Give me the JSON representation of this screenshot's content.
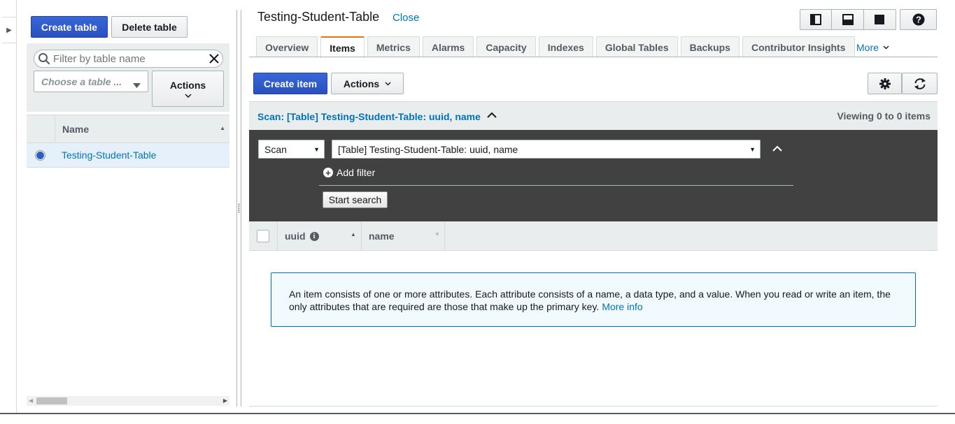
{
  "left_panel": {
    "create_table_label": "Create table",
    "delete_table_label": "Delete table",
    "filter_placeholder": "Filter by table name",
    "choose_table_placeholder": "Choose a table ...",
    "actions_label": "Actions",
    "column_header": "Name",
    "tables": [
      {
        "name": "Testing-Student-Table",
        "selected": true
      }
    ]
  },
  "detail": {
    "title": "Testing-Student-Table",
    "close_label": "Close",
    "tabs": [
      {
        "label": "Overview",
        "active": false
      },
      {
        "label": "Items",
        "active": true
      },
      {
        "label": "Metrics",
        "active": false
      },
      {
        "label": "Alarms",
        "active": false
      },
      {
        "label": "Capacity",
        "active": false
      },
      {
        "label": "Indexes",
        "active": false
      },
      {
        "label": "Global Tables",
        "active": false
      },
      {
        "label": "Backups",
        "active": false
      },
      {
        "label": "Contributor Insights",
        "active": false
      }
    ],
    "more_label": "More"
  },
  "items": {
    "create_item_label": "Create item",
    "actions_label": "Actions",
    "scan_summary": "Scan: [Table] Testing-Student-Table: uuid, name",
    "viewing_text": "Viewing 0 to 0 items",
    "operation_value": "Scan",
    "target_value": "[Table] Testing-Student-Table: uuid, name",
    "add_filter_label": "Add filter",
    "start_search_label": "Start search",
    "columns": [
      "uuid",
      "name"
    ],
    "info_text": "An item consists of one or more attributes. Each attribute consists of a name, a data type, and a value. When you read or write an item, the only attributes that are required are those that make up the primary key.",
    "more_info_label": "More info"
  },
  "colors": {
    "primary": "#2c56c9",
    "link": "#0073bb",
    "active_tab_accent": "#ec7211",
    "scan_panel_bg": "#414141",
    "info_bg": "#f1faff"
  }
}
